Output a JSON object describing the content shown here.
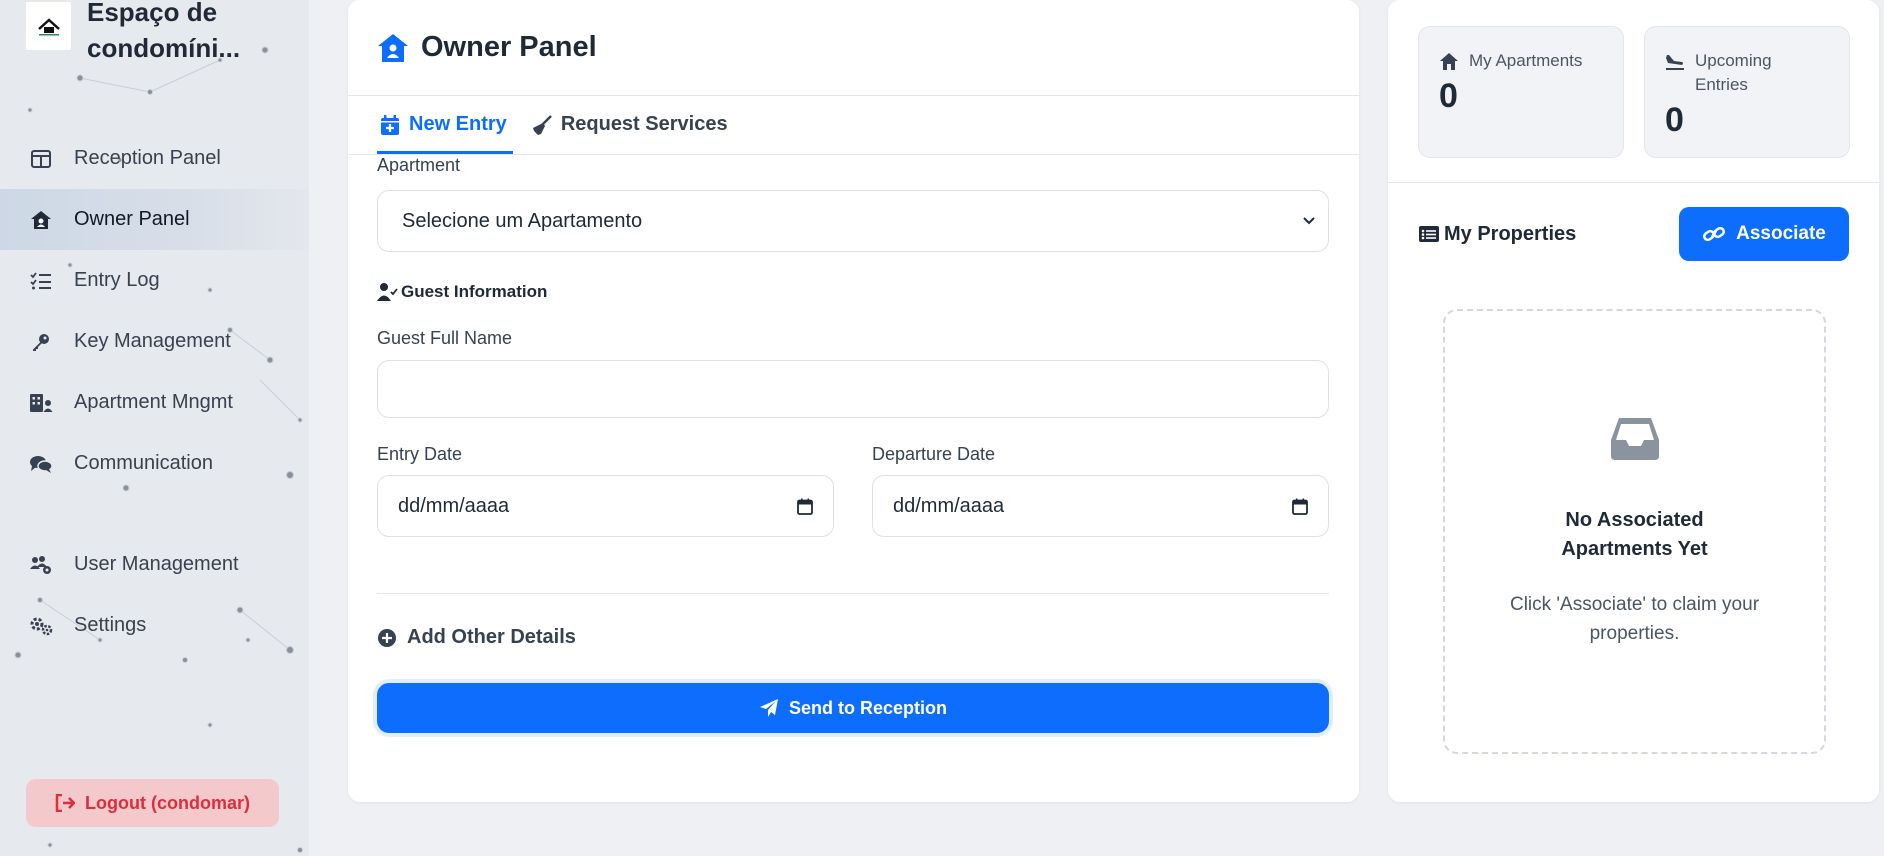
{
  "sidebar": {
    "app_name": "Espaço de condomíni...",
    "items": [
      {
        "label": "Reception Panel",
        "icon": "columns-icon",
        "active": false
      },
      {
        "label": "Owner Panel",
        "icon": "house-user-icon",
        "active": true
      },
      {
        "label": "Entry Log",
        "icon": "list-check-icon",
        "active": false
      },
      {
        "label": "Key Management",
        "icon": "key-icon",
        "active": false
      },
      {
        "label": "Apartment Mngmt",
        "icon": "building-user-icon",
        "active": false
      },
      {
        "label": "Communication",
        "icon": "comments-icon",
        "active": false
      },
      {
        "label": "User Management",
        "icon": "users-gear-icon",
        "active": false
      },
      {
        "label": "Settings",
        "icon": "gears-icon",
        "active": false
      }
    ],
    "logout_label": "Logout (condomar)"
  },
  "main": {
    "title": "Owner Panel",
    "tabs": [
      {
        "label": "New Entry",
        "icon": "calendar-plus-icon",
        "active": true
      },
      {
        "label": "Request Services",
        "icon": "broom-icon",
        "active": false
      }
    ],
    "apartment_label": "Apartment",
    "apartment_selected": "Selecione um Apartamento",
    "guest_section": "Guest Information",
    "guest_name_label": "Guest Full Name",
    "guest_name_value": "",
    "entry_date_label": "Entry Date",
    "entry_date_value": "dd/mm/aaaa",
    "departure_date_label": "Departure Date",
    "departure_date_value": "dd/mm/aaaa",
    "add_details_label": "Add Other Details",
    "send_label": "Send to Reception"
  },
  "right": {
    "stats": [
      {
        "label": "My Apartments",
        "value": "0",
        "icon": "home-icon"
      },
      {
        "label": "Upcoming Entries",
        "value": "0",
        "icon": "plane-arrival-icon"
      }
    ],
    "properties_title": "My Properties",
    "associate_label": "Associate",
    "empty_title": "No Associated Apartments Yet",
    "empty_desc": "Click 'Associate' to claim your properties."
  },
  "colors": {
    "accent": "#0d6efd",
    "logout_bg": "#f3c9cc",
    "logout_text": "#dc2f3e",
    "sidebar_bg": "#e6e9ee",
    "page_bg": "#eef0f4"
  }
}
